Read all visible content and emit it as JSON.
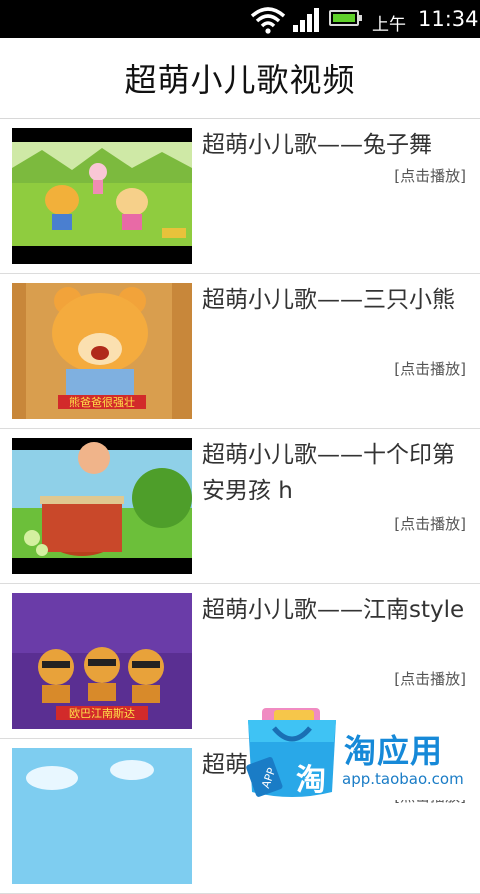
{
  "status_bar": {
    "am_pm": "上午",
    "time": "11:34",
    "icons": [
      "wifi-icon",
      "signal-icon",
      "battery-icon"
    ],
    "battery_color": "#5fd12a"
  },
  "header": {
    "title": "超萌小儿歌视频"
  },
  "videos": [
    {
      "title": "超萌小儿歌——兔子舞",
      "play_label": "[点击播放]",
      "thumb_caption": ""
    },
    {
      "title": "超萌小儿歌——三只小熊",
      "play_label": "[点击播放]",
      "thumb_caption": "熊爸爸很强壮"
    },
    {
      "title": "超萌小儿歌——十个印第安男孩 h",
      "play_label": "[点击播放]",
      "thumb_caption": ""
    },
    {
      "title": "超萌小儿歌——江南style",
      "play_label": "[点击播放]",
      "thumb_caption": "欧巴江南斯达"
    },
    {
      "title": "超萌小儿歌",
      "play_label": "[点击播放]",
      "thumb_caption": ""
    }
  ],
  "ad_banner": {
    "name": "淘应用",
    "url": "app.taobao.com",
    "bag_text": "淘",
    "bag_tag": "APP",
    "accent": "#1689d8"
  }
}
